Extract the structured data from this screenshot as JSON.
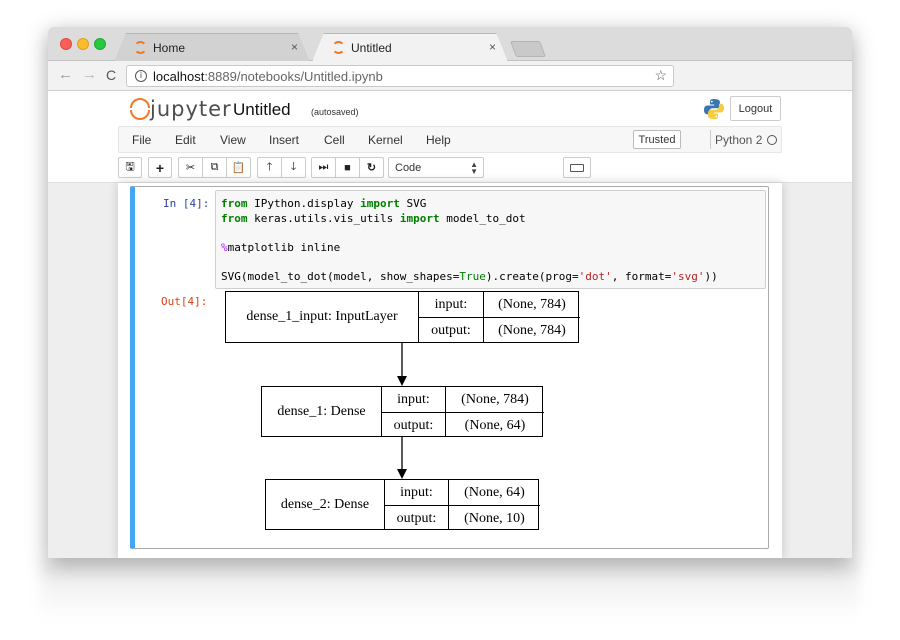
{
  "browser": {
    "tabs": [
      {
        "label": "Home",
        "icon": "jupyter-favicon-icon",
        "close": "×"
      },
      {
        "label": "Untitled",
        "icon": "jupyter-favicon-icon",
        "close": "×"
      }
    ],
    "url_host": "localhost",
    "url_path": ":8889/notebooks/Untitled.ipynb",
    "info": "i",
    "star": "☆",
    "back": "←",
    "forward": "→",
    "reload": "C"
  },
  "jupyter": {
    "logo_word": "jupyter",
    "title": "Untitled",
    "autosaved": "(autosaved)",
    "logout": "Logout",
    "menu": [
      "File",
      "Edit",
      "View",
      "Insert",
      "Cell",
      "Kernel",
      "Help"
    ],
    "trusted": "Trusted",
    "kernel": "Python 2",
    "cell_type": "Code",
    "accent": "#f37726",
    "cell_border": "#42a5f5"
  },
  "toolbar_buttons": [
    {
      "name": "save-icon",
      "glyph": "🖫"
    },
    {
      "name": "insert-cell-icon",
      "glyph": "+"
    },
    {
      "name": "cut-icon",
      "glyph": "✂"
    },
    {
      "name": "copy-icon",
      "glyph": "⧉"
    },
    {
      "name": "paste-icon",
      "glyph": "📋"
    },
    {
      "name": "move-up-icon",
      "glyph": "🡑"
    },
    {
      "name": "move-down-icon",
      "glyph": "🡓"
    },
    {
      "name": "run-icon",
      "glyph": "⏭"
    },
    {
      "name": "stop-icon",
      "glyph": "■"
    },
    {
      "name": "restart-icon",
      "glyph": "↻"
    }
  ],
  "cell": {
    "in_prompt": "In [4]:",
    "out_prompt": "Out[4]:"
  },
  "model_graph": [
    {
      "name": "dense_1_input: InputLayer",
      "input_label": "input:",
      "input_value": "(None, 784)",
      "output_label": "output:",
      "output_value": "(None, 784)"
    },
    {
      "name": "dense_1: Dense",
      "input_label": "input:",
      "input_value": "(None, 784)",
      "output_label": "output:",
      "output_value": "(None, 64)"
    },
    {
      "name": "dense_2: Dense",
      "input_label": "input:",
      "input_value": "(None, 64)",
      "output_label": "output:",
      "output_value": "(None, 10)"
    }
  ]
}
